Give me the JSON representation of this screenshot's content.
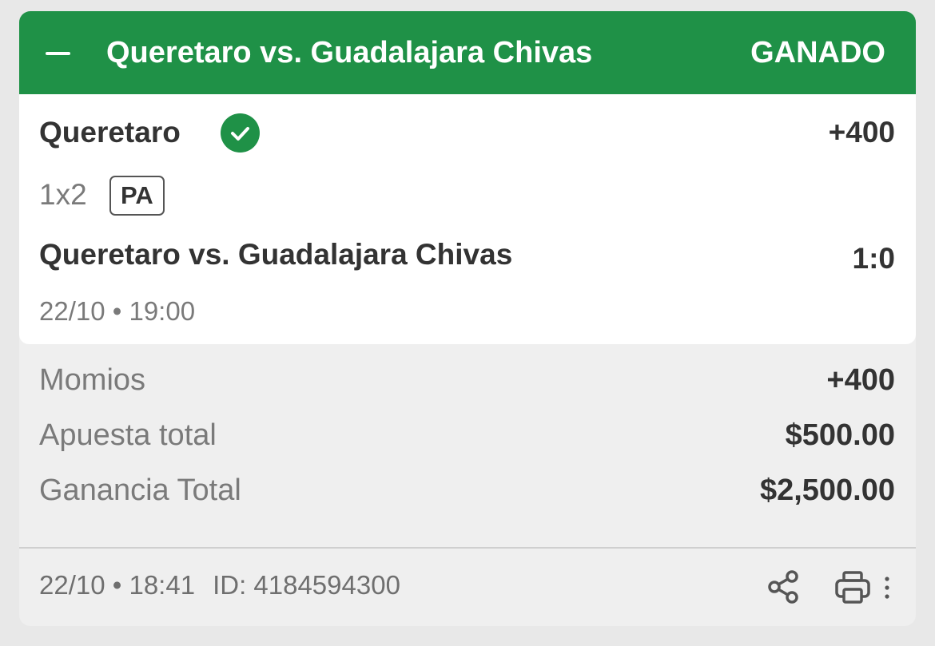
{
  "header": {
    "title": "Queretaro vs. Guadalajara Chivas",
    "status": "GANADO",
    "color": "#1f9147"
  },
  "selection": {
    "name": "Queretaro",
    "odds": "+400",
    "market": "1x2",
    "badge": "PA",
    "event": "Queretaro vs. Guadalajara Chivas",
    "score": "1:0",
    "datetime": "22/10 • 19:00",
    "result_icon": "check-circle-icon"
  },
  "summary": {
    "rows": [
      {
        "label": "Momios",
        "value": "+400"
      },
      {
        "label": "Apuesta total",
        "value": "$500.00"
      },
      {
        "label": "Ganancia Total",
        "value": "$2,500.00"
      }
    ]
  },
  "footer": {
    "datetime": "22/10 • 18:41",
    "id": "ID: 4184594300",
    "icons": [
      "share-icon",
      "print-icon",
      "more-vertical-icon"
    ]
  }
}
